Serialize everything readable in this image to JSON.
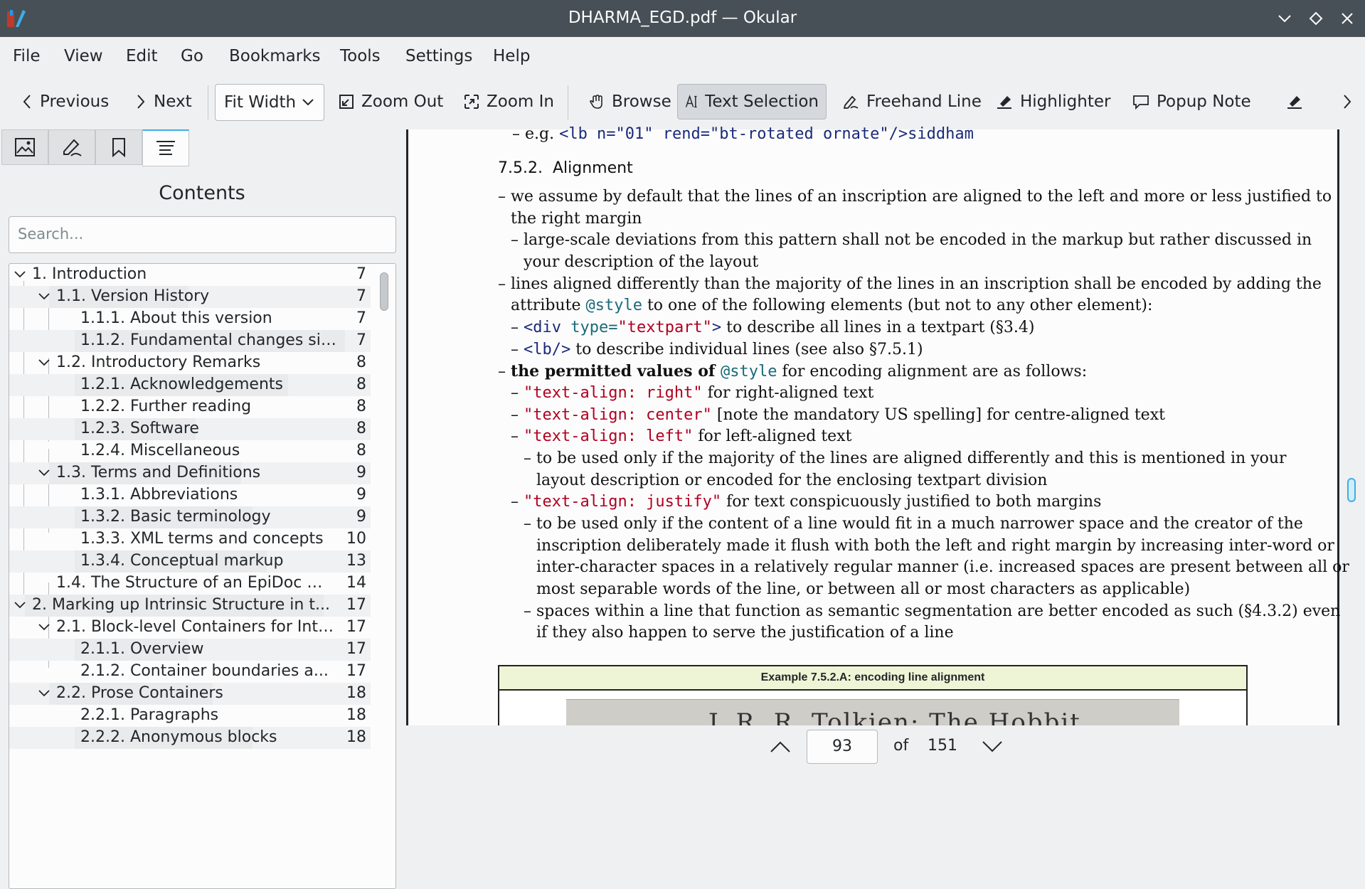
{
  "window": {
    "title": "DHARMA_EGD.pdf — Okular"
  },
  "menu": [
    "File",
    "View",
    "Edit",
    "Go",
    "Bookmarks",
    "Tools",
    "Settings",
    "Help"
  ],
  "toolbar": {
    "previous": "Previous",
    "next": "Next",
    "zoom_value": "Fit Width",
    "zoom_out": "Zoom Out",
    "zoom_in": "Zoom In",
    "browse": "Browse",
    "text_selection": "Text Selection",
    "freehand_line": "Freehand Line",
    "highlighter": "Highlighter",
    "popup_note": "Popup Note"
  },
  "sidebar": {
    "title": "Contents",
    "search_placeholder": "Search...",
    "toc": [
      {
        "label": "1. Introduction",
        "page": "7"
      },
      {
        "label": "1.1. Version History",
        "page": "7"
      },
      {
        "label": "1.1.1. About this version",
        "page": "7"
      },
      {
        "label": "1.1.2. Fundamental changes sin...",
        "page": "7"
      },
      {
        "label": "1.2. Introductory Remarks",
        "page": "8"
      },
      {
        "label": "1.2.1. Acknowledgements",
        "page": "8"
      },
      {
        "label": "1.2.2. Further reading",
        "page": "8"
      },
      {
        "label": "1.2.3. Software",
        "page": "8"
      },
      {
        "label": "1.2.4. Miscellaneous",
        "page": "8"
      },
      {
        "label": "1.3. Terms and Definitions",
        "page": "9"
      },
      {
        "label": "1.3.1. Abbreviations",
        "page": "9"
      },
      {
        "label": "1.3.2. Basic terminology",
        "page": "9"
      },
      {
        "label": "1.3.3. XML terms and concepts",
        "page": "10"
      },
      {
        "label": "1.3.4. Conceptual markup",
        "page": "13"
      },
      {
        "label": "1.4. The Structure of an EpiDoc E...",
        "page": "14"
      },
      {
        "label": "2. Marking up Intrinsic Structure in t...",
        "page": "17"
      },
      {
        "label": "2.1. Block-level Containers for Intr...",
        "page": "17"
      },
      {
        "label": "2.1.1. Overview",
        "page": "17"
      },
      {
        "label": "2.1.2. Container boundaries a...",
        "page": "17"
      },
      {
        "label": "2.2. Prose Containers",
        "page": "18"
      },
      {
        "label": "2.2.1. Paragraphs",
        "page": "18"
      },
      {
        "label": "2.2.2. Anonymous blocks",
        "page": "18"
      }
    ]
  },
  "document": {
    "top_line": {
      "prefix": "– e.g. ",
      "code": "<lb n=\"01\" rend=\"bt-rotated ornate\"/>siddham"
    },
    "heading_num": "7.5.2.",
    "heading_text": "Alignment",
    "p1a": "– we assume by default that the lines of an inscription are aligned to the left and more or less justified to",
    "p1b": "the right margin",
    "p2a": "– large-scale deviations from this pattern shall not be encoded in the markup but rather discussed in",
    "p2b": "your description of the layout",
    "p3a": "– lines aligned differently than the majority of the lines in an inscription shall be encoded by adding the",
    "p3b_pre": "attribute ",
    "p3b_code": "@style",
    "p3b_post": " to one of the following elements (but not to any other element):",
    "p4_dash": "– ",
    "p4_code_a": "<div ",
    "p4_code_b": "type=",
    "p4_code_c": "\"textpart\"",
    "p4_code_d": ">",
    "p4_post": " to describe all lines in a textpart (§3.4)",
    "p5_code": "<lb/>",
    "p5_post": " to describe individual lines (see also §7.5.1)",
    "p6_bold": "the permitted values of ",
    "p6_code": "@style",
    "p6_post": " for encoding alignment are as follows:",
    "v1_code": "\"text-align: right\"",
    "v1_post": " for right-aligned text",
    "v2_code": "\"text-align: center\"",
    "v2_post": " [note the mandatory US spelling] for centre-aligned text",
    "v3_code": "\"text-align: left\"",
    "v3_post": " for left-aligned text",
    "v3a": "– to be used only if the majority of the lines are aligned differently and this is mentioned in your",
    "v3b": "layout description or encoded for the enclosing textpart division",
    "v4_code": "\"text-align: justify\"",
    "v4_post": " for text conspicuously justified to both margins",
    "v4a": "– to be used only if the content of a line would fit in a much narrower space and the creator of the",
    "v4b": "inscription deliberately made it flush with both the left and right margin by increasing inter-word or",
    "v4c": "inter-character spaces in a relatively regular manner (i.e. increased spaces are present between all or",
    "v4d": "most separable words of the line, or between all or most characters as applicable)",
    "v5a": "– spaces within a line that function as semantic segmentation are better encoded as such (§4.3.2) even",
    "v5b": "if they also happen to serve the justification of a line",
    "example_title": "Example 7.5.2.A: encoding line alignment",
    "example_image_text": "J. R. R. Tolkien: The Hobbit"
  },
  "pagenav": {
    "current": "93",
    "of": "of",
    "total": "151"
  }
}
